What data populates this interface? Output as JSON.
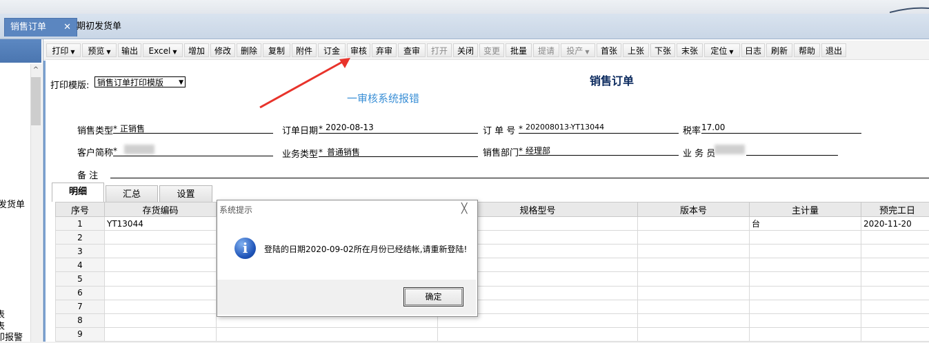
{
  "tabs": [
    {
      "label": "销售订单",
      "close": "✕"
    },
    {
      "label": "期初发货单"
    }
  ],
  "left_panel": {
    "items": [
      "发货单",
      "表",
      "表",
      "印报警"
    ]
  },
  "toolbar": {
    "buttons": [
      "打印",
      "预览",
      "输出",
      "Excel",
      "增加",
      "修改",
      "删除",
      "复制",
      "附件",
      "订金",
      "审核",
      "弃审",
      "查审",
      "打开",
      "关闭",
      "变更",
      "批量",
      "提请",
      "投产",
      "首张",
      "上张",
      "下张",
      "末张",
      "定位",
      "日志",
      "刷新",
      "帮助",
      "退出"
    ]
  },
  "form": {
    "print_template_label": "打印模版:",
    "print_template_value": "销售订单打印模版",
    "title": "销售订单",
    "annotation": "一审核系统报错",
    "sales_type_label": "销售类型",
    "sales_type_value": "正销售",
    "order_date_label": "订单日期",
    "order_date_value": "2020-08-13",
    "order_no_label": "订 单 号",
    "order_no_value": "202008013-YT13044",
    "tax_rate_label": "税率",
    "tax_rate_value": "17.00",
    "customer_label": "客户简称",
    "business_type_label": "业务类型",
    "business_type_value": "普通销售",
    "sales_dept_label": "销售部门",
    "sales_dept_value": "经理部",
    "salesman_label": "业 务 员",
    "remark_label": "备    注",
    "required_mark": "*"
  },
  "detail_tabs": [
    "明细",
    "汇总",
    "设置"
  ],
  "grid": {
    "columns": [
      "序号",
      "存货编码",
      "",
      "规格型号",
      "版本号",
      "主计量",
      "预完工日"
    ],
    "rows": [
      {
        "n": "1",
        "code": "YT13044",
        "unit": "台",
        "date": "2020-11-20"
      },
      {
        "n": "2"
      },
      {
        "n": "3"
      },
      {
        "n": "4"
      },
      {
        "n": "5"
      },
      {
        "n": "6"
      },
      {
        "n": "7"
      },
      {
        "n": "8"
      },
      {
        "n": "9"
      }
    ]
  },
  "dialog": {
    "title": "系统提示",
    "close": "╳",
    "icon": "i",
    "message": "登陆的日期2020-09-02所在月份已经结帐,请重新登陆!",
    "ok_label": "确定"
  },
  "colors": {
    "active_tab": "#5b86c0",
    "annotation": "#3a8fd6",
    "arrow": "#e8332b",
    "title": "#0b2a5e"
  }
}
